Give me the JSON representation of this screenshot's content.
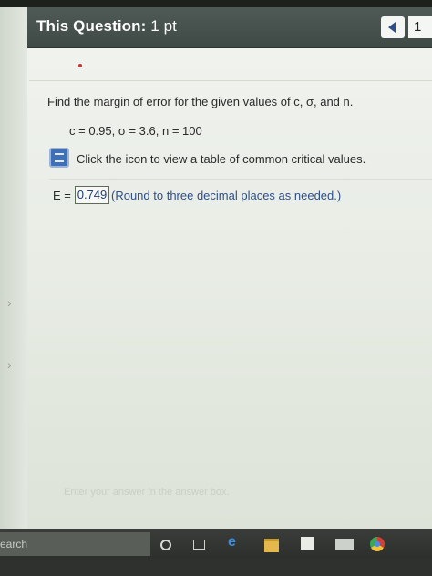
{
  "header": {
    "title": "This Question:",
    "points": "1 pt",
    "question_number": "1"
  },
  "question": {
    "prompt": "Find the margin of error for the given values of c, σ, and n.",
    "parameters": "c = 0.95, σ = 3.6, n = 100",
    "hint": "Click the icon to view a table of common critical values.",
    "answer_label": "E =",
    "answer_value": "0.749",
    "answer_note": "(Round to three decimal places as needed.)",
    "footer_hint": "Enter your answer in the answer box."
  },
  "taskbar": {
    "search_text": "earch"
  },
  "icons": {
    "nav_prev": "chevron-left-icon",
    "table": "book-icon",
    "cortana": "cortana-icon",
    "task_view": "task-view-icon",
    "edge": "edge-icon",
    "explorer": "folder-icon",
    "store": "store-icon",
    "mail": "mail-icon",
    "chrome": "chrome-icon"
  },
  "colors": {
    "header_bg": "#4a5551",
    "accent_blue": "#2f4f8a",
    "screen_bg": "#e9ede6"
  }
}
